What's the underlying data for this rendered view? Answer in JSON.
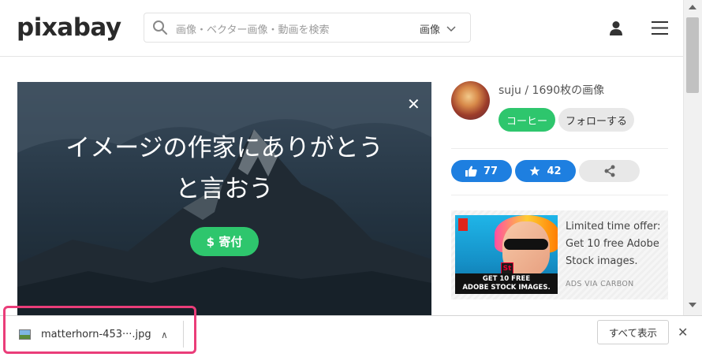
{
  "header": {
    "logo": "pixabay",
    "search_placeholder": "画像・ベクター画像・動画を検索",
    "search_type": "画像"
  },
  "hero": {
    "title_line1": "イメージの作家にありがとう",
    "title_line2": "と言おう",
    "donate_label": "$ 寄付",
    "close_symbol": "✕"
  },
  "sidebar": {
    "author": "suju / 1690枚の画像",
    "coffee_label": "コーヒー",
    "follow_label": "フォローする",
    "likes": "77",
    "favorites": "42"
  },
  "ad": {
    "text": "Limited time offer: Get 10 free Adobe Stock images.",
    "via": "ADS VIA CARBON",
    "banner_line1": "GET 10 FREE",
    "banner_line2": "ADOBE STOCK IMAGES.",
    "st_badge": "St"
  },
  "download_bar": {
    "file_name": "matterhorn-453···.jpg",
    "show_all_label": "すべて表示",
    "close_symbol": "✕",
    "chevron": "∧"
  },
  "colors": {
    "green": "#2ec66d",
    "blue": "#1e7fe0",
    "highlight": "#ea3d79"
  }
}
